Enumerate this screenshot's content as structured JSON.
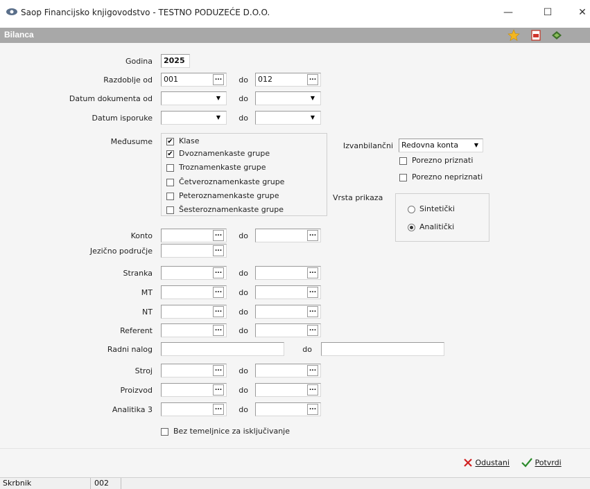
{
  "window": {
    "title": "Saop Financijsko knjigovodstvo - TESTNO PODUZEĆE D.O.O.",
    "minimize": "—",
    "maximize": "☐",
    "close": "✕"
  },
  "header": {
    "title": "Bilanca"
  },
  "form": {
    "godina": {
      "label": "Godina",
      "value": "2025"
    },
    "razdoblje": {
      "label": "Razdoblje od",
      "from": "001",
      "to_label": "do",
      "to": "012"
    },
    "datum_dokumenta": {
      "label": "Datum dokumenta od",
      "to_label": "do"
    },
    "datum_isporuke": {
      "label": "Datum isporuke",
      "to_label": "do"
    },
    "medjusume": {
      "label": "Međusume",
      "items": [
        {
          "label": "Klase",
          "checked": true
        },
        {
          "label": "Dvoznamenkaste grupe",
          "checked": true
        },
        {
          "label": "Troznamenkaste grupe",
          "checked": false
        },
        {
          "label": "Četveroznamenkaste grupe",
          "checked": false
        },
        {
          "label": "Peteroznamenkaste grupe",
          "checked": false
        },
        {
          "label": "Šesteroznamenkaste grupe",
          "checked": false
        }
      ]
    },
    "izvanbilancni": {
      "label": "Izvanbilančni",
      "value": "Redovna konta"
    },
    "porezno_priznati": {
      "label": "Porezno priznati",
      "checked": false
    },
    "porezno_nepriznati": {
      "label": "Porezno nepriznati",
      "checked": false
    },
    "vrsta_prikaza": {
      "label": "Vrsta prikaza",
      "options": [
        {
          "label": "Sintetički",
          "selected": false
        },
        {
          "label": "Analitički",
          "selected": true
        }
      ]
    },
    "konto": {
      "label": "Konto",
      "to_label": "do"
    },
    "jezicno": {
      "label": "Jezično područje"
    },
    "stranka": {
      "label": "Stranka",
      "to_label": "do"
    },
    "mt": {
      "label": "MT",
      "to_label": "do"
    },
    "nt": {
      "label": "NT",
      "to_label": "do"
    },
    "referent": {
      "label": "Referent",
      "to_label": "do"
    },
    "radni_nalog": {
      "label": "Radni nalog",
      "to_label": "do"
    },
    "stroj": {
      "label": "Stroj",
      "to_label": "do"
    },
    "proizvod": {
      "label": "Proizvod",
      "to_label": "do"
    },
    "analitika3": {
      "label": "Analitika 3",
      "to_label": "do"
    },
    "bez_temeljnice": {
      "label": "Bez temeljnice za isključivanje",
      "checked": false
    }
  },
  "buttons": {
    "odustani": "Odustani",
    "potvrdi": "Potvrdi"
  },
  "statusbar": {
    "user_label": "Skrbnik",
    "user_value": "002"
  },
  "colors": {
    "header_bg": "#a8a8a8",
    "cancel_red": "#d02020",
    "confirm_green": "#2a8a2a"
  }
}
